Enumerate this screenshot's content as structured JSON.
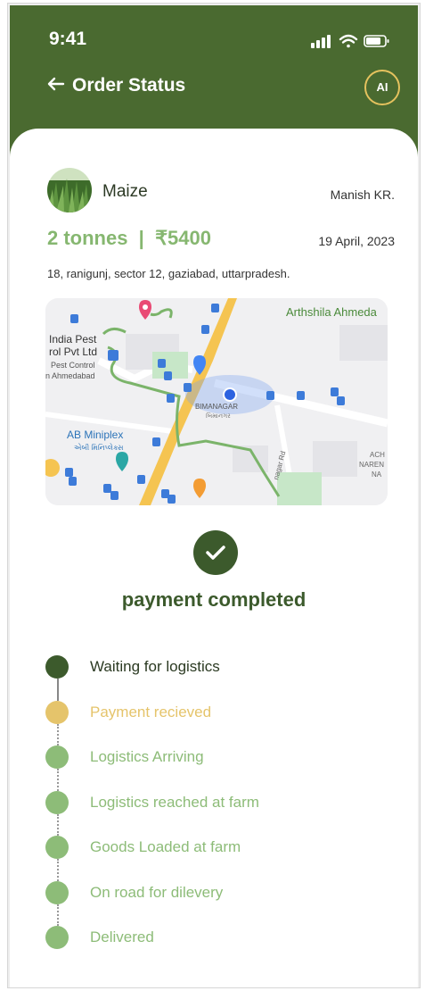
{
  "status_bar": {
    "time": "9:41"
  },
  "topbar": {
    "title": "Order Status",
    "back_icon": "back-arrow-icon",
    "badge": "AI"
  },
  "order": {
    "crop": "Maize",
    "farmer": "Manish KR.",
    "quantity_price": "2 tonnes  |  ₹5400",
    "date": "19 April, 2023",
    "address": "18, ranigunj, sector 12, gaziabad, uttarpradesh."
  },
  "map": {
    "labels": {
      "arthshila": "Arthshila Ahmeda",
      "india_pest_1": "India Pest",
      "india_pest_2": "rol Pvt Ltd",
      "pest_control": "Pest Control",
      "n_ahmedabad": "n Ahmedabad",
      "bimanagar": "BIMANAGAR",
      "bimanagar_gu": "બિમાનગર",
      "ab_miniplex": "AB Miniplex",
      "ab_miniplex_gu": "એબી મિનિપ્લેક્સ",
      "nagar_rd": "nagar Rd",
      "ach": "ACH",
      "naren": "NAREN",
      "na": "NA"
    }
  },
  "payment": {
    "title": "payment completed",
    "icon": "check-icon"
  },
  "timeline": {
    "steps": [
      {
        "label": "Waiting for logistics",
        "state": "current"
      },
      {
        "label": "Payment recieved",
        "state": "done"
      },
      {
        "label": "Logistics Arriving",
        "state": "pending"
      },
      {
        "label": "Logistics reached at farm",
        "state": "pending"
      },
      {
        "label": "Goods Loaded at farm",
        "state": "pending"
      },
      {
        "label": "On road for dilevery",
        "state": "pending"
      },
      {
        "label": "Delivered",
        "state": "pending"
      }
    ]
  },
  "colors": {
    "header_bg": "#4a6a30",
    "current_dot": "#3c5a2c",
    "done_dot": "#e5c46b",
    "pending_dot": "#8dbc78",
    "price_text": "#86b770"
  }
}
